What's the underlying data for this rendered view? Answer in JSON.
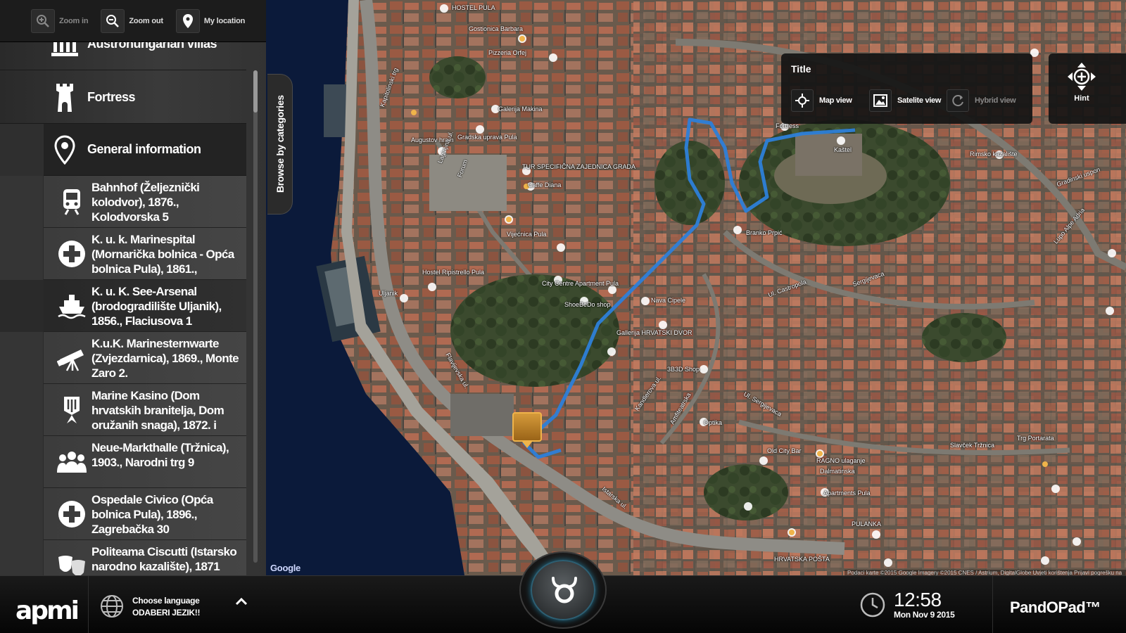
{
  "toolbar": {
    "zoom_in": "Zoom in",
    "zoom_out": "Zoom out",
    "my_location": "My location"
  },
  "sidebar": {
    "browse_tab": "Browse by categories",
    "categories": [
      {
        "label": "Austrohungarian villas",
        "icon": "columns-icon"
      },
      {
        "label": "Fortress",
        "icon": "tower-icon"
      },
      {
        "label": "General information",
        "icon": "map-pin-icon",
        "active": true
      }
    ],
    "pois": [
      {
        "label": "Bahnhof (Željeznički kolodvor), 1876., Kolodvorska 5",
        "icon": "train-icon"
      },
      {
        "label": "K. u. k. Marinespital (Mornarička bolnica - Opća bolnica Pula), 1861.,",
        "icon": "medical-cross-icon"
      },
      {
        "label": "K. u. K. See-Arsenal (brodogradilište Uljanik), 1856., Flaciusova 1",
        "icon": "ship-icon",
        "selected": true
      },
      {
        "label": "K.u.K. Marinesternwarte (Zvjezdarnica), 1869., Monte Zaro 2.",
        "icon": "telescope-icon"
      },
      {
        "label": "Marine Kasino (Dom hrvatskih branitelja, Dom oružanih snaga), 1872. i",
        "icon": "monument-icon"
      },
      {
        "label": "Neue-Markthalle (Tržnica), 1903., Narodni trg 9",
        "icon": "people-icon"
      },
      {
        "label": "Ospedale Civico (Opća bolnica Pula), 1896., Zagrebačka 30",
        "icon": "medical-cross-icon"
      },
      {
        "label": "Politeama Ciscutti (Istarsko narodno kazalište), 1871",
        "icon": "theater-masks-icon"
      }
    ]
  },
  "map_panel": {
    "title": "Title",
    "map_view": "Map view",
    "satellite_view": "Satelite view",
    "hybrid_view": "Hybrid view",
    "hint": "Hint"
  },
  "map": {
    "google": "Google",
    "attribution": "Podaci karte ©2015 Google Imagery ©2015 CNES / Astrium, DigitalGlobe   Uvjeti korištenja   Prijavi pogrešku na karti",
    "labels": [
      "HOSTEL PULA",
      "Gostionica Barbara",
      "Pizzeria Orfej",
      "Galerija Makina",
      "Augustov hram",
      "Gradska uprava Pula",
      "TUR SPECIFIČNA ZAJEDNICA GRADA",
      "Caffe Diana",
      "Kapitolinski trg",
      "Forum",
      "Vijećnica Pula",
      "Hostel Ripistrello Pula",
      "City Centre Apartment Pula",
      "Uljanik",
      "ShoeBeDo shop",
      "Nava Cipele",
      "Fortress",
      "Kaštel",
      "Rimsko kazalište",
      "Gradinski uspon",
      "Branko Prpić",
      "Gallerija HRVATSKI DVOR",
      "3B3D Shop",
      "Optika",
      "Old City Bar",
      "RAGNO ulaganje",
      "Slavček Tržnica",
      "Trg Portarata",
      "Lupo Alpe Adria",
      "Sergijevaca",
      "Dalmatinska",
      "Apartments Pula",
      "PULANKA",
      "HRVATSKA POŠTA",
      "Amfiteatrska",
      "Ul. Sergijevaca",
      "Flavijevska ul.",
      "Istarska ul.",
      "Kandlerova ul.",
      "Laginjina ul.",
      "Ul. Castropola"
    ]
  },
  "bottombar": {
    "logo": "apmi",
    "lang_line1": "Choose language",
    "lang_line2": "ODABERI JEZIK!!",
    "time": "12:58",
    "date": "Mon Nov 9 2015",
    "brand": "PandOPad™"
  },
  "colors": {
    "route": "#2d7fd9",
    "marker": "#c4862a",
    "sea": "#0b1a3a",
    "accent_ring": "#2d6f8a"
  }
}
